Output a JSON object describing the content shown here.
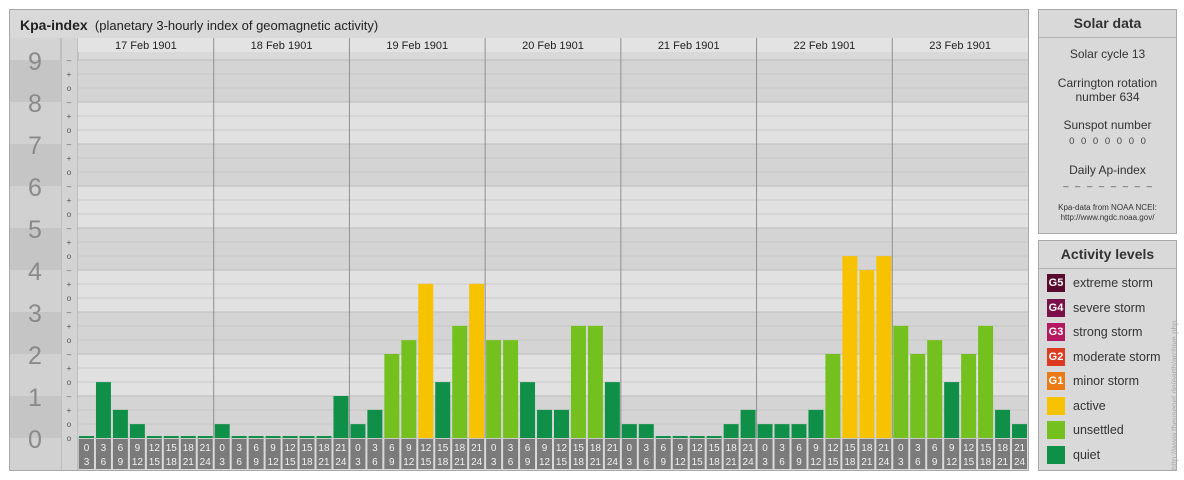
{
  "title": "Kpa-index",
  "subtitle": "(planetary 3-hourly index of geomagnetic activity)",
  "chart_data": {
    "type": "bar",
    "title": "Kpa-index",
    "subtitle": "(planetary 3-hourly index of geomagnetic activity)",
    "ylim": [
      0,
      9
    ],
    "y_ticks": [
      "0",
      "1",
      "2",
      "3",
      "4",
      "5",
      "6",
      "7",
      "8",
      "9"
    ],
    "minor_marks": [
      "o",
      "+",
      "–"
    ],
    "days": [
      "17 Feb 1901",
      "18 Feb 1901",
      "19 Feb 1901",
      "20 Feb 1901",
      "21 Feb 1901",
      "22 Feb 1901",
      "23 Feb 1901"
    ],
    "hour_top": [
      "0",
      "3",
      "6",
      "9",
      "12",
      "15",
      "18",
      "21"
    ],
    "hour_bottom": [
      "3",
      "6",
      "9",
      "12",
      "15",
      "18",
      "21",
      "24"
    ],
    "values": [
      0.0,
      1.33,
      0.67,
      0.33,
      0.0,
      0.0,
      0.0,
      0.0,
      0.33,
      0.0,
      0.0,
      0.0,
      0.0,
      0.0,
      0.0,
      1.0,
      0.33,
      0.67,
      2.0,
      2.33,
      3.67,
      1.33,
      2.67,
      3.67,
      2.33,
      2.33,
      1.33,
      0.67,
      0.67,
      2.67,
      2.67,
      1.33,
      0.33,
      0.33,
      0.0,
      0.0,
      0.0,
      0.0,
      0.33,
      0.67,
      0.33,
      0.33,
      0.33,
      0.67,
      2.0,
      4.33,
      4.0,
      4.33,
      2.67,
      2.0,
      2.33,
      1.33,
      2.0,
      2.67,
      0.67,
      0.33
    ],
    "levels": [
      {
        "min": 0,
        "color": "#0f8f48"
      },
      {
        "min": 2,
        "color": "#74c01f"
      },
      {
        "min": 3.5,
        "color": "#f7c200"
      }
    ],
    "grid": true
  },
  "solar": {
    "title": "Solar data",
    "cycle": "Solar cycle 13",
    "carrington_line1": "Carrington rotation",
    "carrington_line2": "number 634",
    "sunspot_label": "Sunspot number",
    "sunspot_values": "0 0 0 0 0 0 0",
    "ap_label": "Daily Ap-index",
    "ap_values": "– – – – – – – –",
    "source_line1": "Kpa-data from NOAA NCEI:",
    "source_line2": "http://www.ngdc.noaa.gov/"
  },
  "activity": {
    "title": "Activity levels",
    "items": [
      {
        "badge": "G5",
        "label": "extreme storm",
        "color": "#5a0a2d"
      },
      {
        "badge": "G4",
        "label": "severe storm",
        "color": "#7a1048"
      },
      {
        "badge": "G3",
        "label": "strong storm",
        "color": "#b5185e"
      },
      {
        "badge": "G2",
        "label": "moderate storm",
        "color": "#dc3b1f"
      },
      {
        "badge": "G1",
        "label": "minor storm",
        "color": "#ec7a14"
      },
      {
        "badge": "",
        "label": "active",
        "color": "#f7c200"
      },
      {
        "badge": "",
        "label": "unsettled",
        "color": "#74c01f"
      },
      {
        "badge": "",
        "label": "quiet",
        "color": "#0f8f48"
      }
    ]
  },
  "watermark": "http://www.theusenet.de/earth/archive.php"
}
